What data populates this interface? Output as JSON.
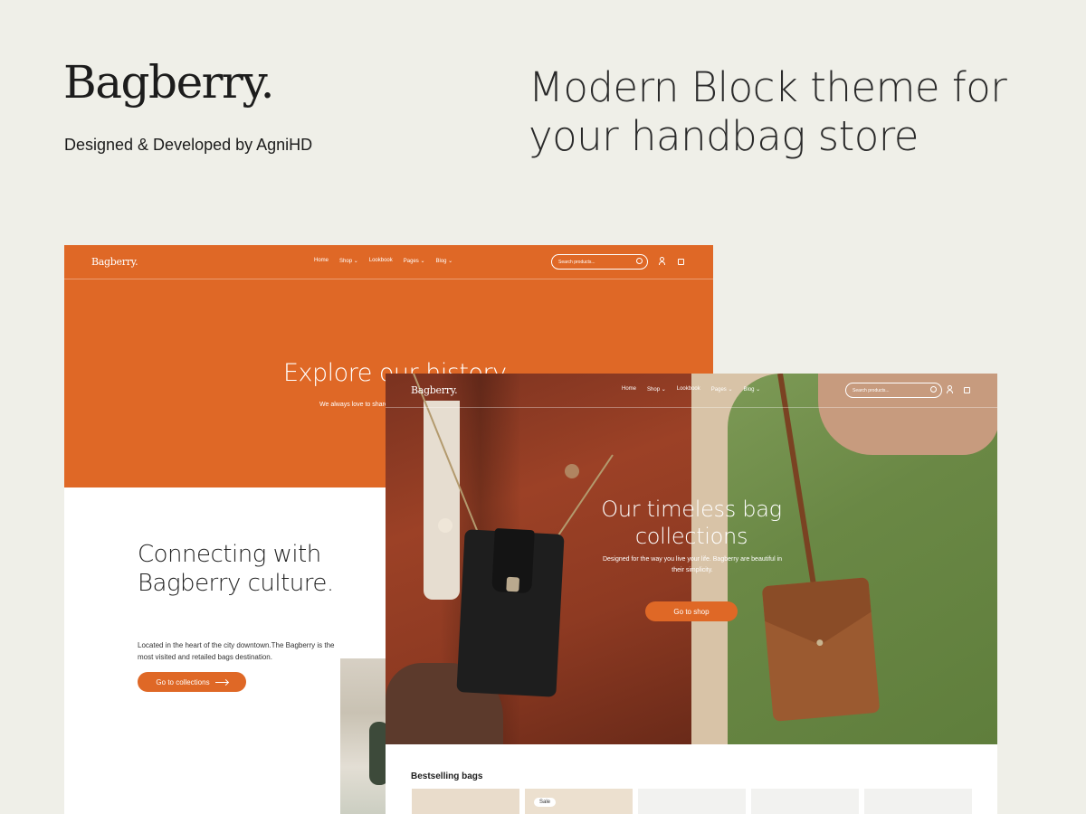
{
  "brand": {
    "logo": "Bagberry.",
    "credit": "Designed & Developed by AgniHD",
    "tagline": "Modern Block theme for your handbag store"
  },
  "colors": {
    "accent": "#df6826",
    "background": "#efefe8"
  },
  "nav": {
    "logo": "Bagberry.",
    "links": [
      "Home",
      "Shop ⌄",
      "Lookbook",
      "Pages ⌄",
      "Blog ⌄"
    ],
    "search_placeholder": "Search products..."
  },
  "back_screen": {
    "hero_title": "Explore our history",
    "hero_subtitle": "We always love to share our story",
    "culture_title": "Connecting with Bagberry culture.",
    "culture_desc": "Located in the heart of the city downtown.The Bagberry is the most visited and retailed bags destination.",
    "cta": "Go to collections"
  },
  "front_screen": {
    "hero_title": "Our timeless bag collections",
    "hero_subtitle": "Designed for the way you live your life. Bagberry are beautiful in their simplicity.",
    "cta": "Go to shop",
    "bestselling": "Bestselling bags",
    "product_badge": "Sale",
    "product_colors": [
      "#e9dccb",
      "#ece0cf",
      "#f2f2f0",
      "#f2f2f0",
      "#f2f2f0"
    ]
  }
}
